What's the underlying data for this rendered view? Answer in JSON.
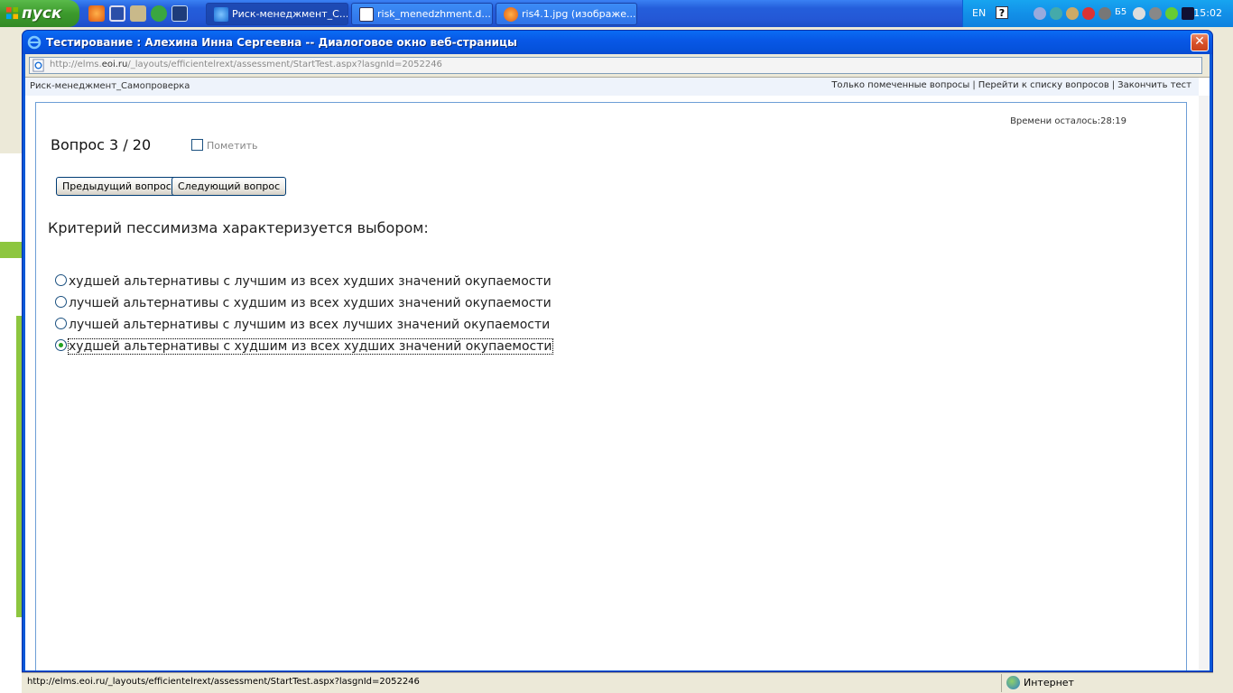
{
  "taskbar": {
    "start_label": "пуск",
    "tasks": [
      {
        "label": "Риск-менеджмент_С...",
        "icon": "ie-icon",
        "active": true
      },
      {
        "label": "risk_menedzhment.d...",
        "icon": "word-doc-icon",
        "active": false
      },
      {
        "label": "ris4.1.jpg (изображе...",
        "icon": "firefox-icon",
        "active": false
      }
    ],
    "tray": {
      "language": "EN",
      "help": "?",
      "indicator": "Б5",
      "clock": "15:02"
    }
  },
  "dialog": {
    "title": "Тестирование : Алехина Инна Сергеевна -- Диалоговое окно веб-страницы",
    "close": "✕",
    "address_prefix": "http://elms.",
    "address_host": "eoi.ru",
    "address_suffix": "/_layouts/efficientelrext/assessment/StartTest.aspx?lasgnId=2052246"
  },
  "page": {
    "breadcrumb": "Риск-менеджмент_Самопроверка",
    "links": {
      "flagged_only": "Только помеченные вопросы",
      "question_list": "Перейти к списку вопросов",
      "finish": "Закончить тест",
      "separator": "|"
    },
    "timer": "Времени осталось:28:19",
    "question_number": "Вопрос 3 / 20",
    "mark_label": "Пометить",
    "prev_button": "Предыдущий вопрос",
    "next_button": "Следующий вопрос",
    "question_text": "Критерий пессимизма характеризуется выбором:",
    "answers": [
      {
        "text": "худшей альтернативы с лучшим из всех худших значений окупаемости",
        "selected": false
      },
      {
        "text": "лучшей альтернативы с худшим из всех худших значений окупаемости",
        "selected": false
      },
      {
        "text": "лучшей альтернативы с лучшим из всех лучших значений окупаемости",
        "selected": false
      },
      {
        "text": "худшей альтернативы с худшим из всех худших значений окупаемости",
        "selected": true
      }
    ]
  },
  "statusbar": {
    "url": "http://elms.eoi.ru/_layouts/efficientelrext/assessment/StartTest.aspx?lasgnId=2052246",
    "zone": "Интернет"
  }
}
